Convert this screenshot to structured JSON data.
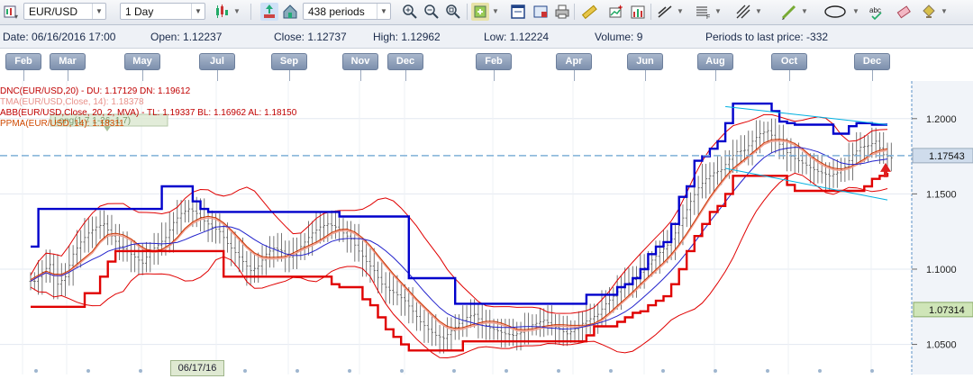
{
  "toolbar": {
    "symbol": "EUR/USD",
    "timeframe": "1 Day",
    "periods": "438 periods"
  },
  "info": {
    "date": "Date: 06/16/2016 17:00",
    "open": "Open: 1.12237",
    "close": "Close: 1.12737",
    "high": "High: 1.12962",
    "low": "Low: 1.12224",
    "volume": "Volume: 9",
    "periods_to_last": "Periods to last price: -332"
  },
  "months": [
    "Feb",
    "Mar",
    "May",
    "Jul",
    "Sep",
    "Nov",
    "Dec",
    "Feb",
    "Apr",
    "Jun",
    "Aug",
    "Oct",
    "Dec"
  ],
  "legend": [
    {
      "text": "DNC(EUR/USD,20) - DU: 1.17129  DN: 1.19612",
      "color": "#c00000"
    },
    {
      "text": "TMA(EUR/USD,Close, 14): 1.18378",
      "color": "#e8908a"
    },
    {
      "text": "ABB(EUR/USD,Close, 20, 2, MVA) - TL: 1.19337  BL: 1.16962  AL: 1.18150",
      "color": "#c00000"
    },
    {
      "text": "PPMA(EUR/USD, 14): 1.18311",
      "color": "#d04a00"
    }
  ],
  "overlay_tag": "Long(1.7 1-26. 1.7)",
  "bottom_date": "06/17/16",
  "chart_data": {
    "type": "line",
    "y_ticks": [
      "1.2000",
      "1.1500",
      "1.1000",
      "1.0500"
    ],
    "ylim": [
      1.03,
      1.225
    ],
    "current_price": "1.17543",
    "crosshair_price": "1.07314",
    "colors": {
      "donchian_upper": "#0000cc",
      "donchian_lower": "#e00000",
      "bollinger": "#e00000",
      "ma": "#cc3300",
      "ma_blue": "#2222cc",
      "bars": "#555555",
      "channel": "#00b0e0",
      "crosshair": "#7fb0d8"
    },
    "series": [
      {
        "name": "Close",
        "values": [
          1.092,
          1.098,
          1.103,
          1.09,
          1.095,
          1.11,
          1.118,
          1.124,
          1.128,
          1.13,
          1.122,
          1.115,
          1.112,
          1.108,
          1.104,
          1.112,
          1.116,
          1.121,
          1.131,
          1.137,
          1.14,
          1.137,
          1.132,
          1.128,
          1.125,
          1.117,
          1.111,
          1.105,
          1.099,
          1.102,
          1.11,
          1.114,
          1.112,
          1.108,
          1.112,
          1.118,
          1.124,
          1.128,
          1.13,
          1.128,
          1.124,
          1.12,
          1.112,
          1.105,
          1.099,
          1.09,
          1.086,
          1.083,
          1.079,
          1.072,
          1.065,
          1.06,
          1.056,
          1.054,
          1.059,
          1.064,
          1.068,
          1.07,
          1.064,
          1.061,
          1.059,
          1.057,
          1.056,
          1.058,
          1.062,
          1.064,
          1.066,
          1.063,
          1.06,
          1.057,
          1.06,
          1.064,
          1.067,
          1.07,
          1.077,
          1.082,
          1.088,
          1.091,
          1.095,
          1.101,
          1.106,
          1.111,
          1.116,
          1.124,
          1.134,
          1.145,
          1.154,
          1.16,
          1.164,
          1.166,
          1.173,
          1.178,
          1.179,
          1.185,
          1.19,
          1.192,
          1.186,
          1.18,
          1.175,
          1.172,
          1.169,
          1.166,
          1.164,
          1.162,
          1.164,
          1.168,
          1.176,
          1.181,
          1.182,
          1.185,
          1.176,
          1.174
        ]
      },
      {
        "name": "Donchian Upper",
        "values": [
          1.115,
          1.14,
          1.14,
          1.14,
          1.14,
          1.14,
          1.14,
          1.14,
          1.14,
          1.14,
          1.14,
          1.14,
          1.14,
          1.14,
          1.14,
          1.14,
          1.14,
          1.155,
          1.155,
          1.155,
          1.155,
          1.145,
          1.14,
          1.138,
          1.138,
          1.138,
          1.138,
          1.138,
          1.138,
          1.138,
          1.138,
          1.138,
          1.138,
          1.138,
          1.138,
          1.138,
          1.138,
          1.138,
          1.138,
          1.138,
          1.135,
          1.135,
          1.135,
          1.135,
          1.135,
          1.135,
          1.135,
          1.135,
          1.135,
          1.094,
          1.094,
          1.094,
          1.094,
          1.094,
          1.094,
          1.077,
          1.077,
          1.077,
          1.077,
          1.077,
          1.077,
          1.077,
          1.077,
          1.077,
          1.077,
          1.077,
          1.077,
          1.077,
          1.077,
          1.077,
          1.077,
          1.077,
          1.083,
          1.083,
          1.083,
          1.083,
          1.088,
          1.09,
          1.094,
          1.1,
          1.11,
          1.115,
          1.118,
          1.13,
          1.148,
          1.155,
          1.172,
          1.175,
          1.18,
          1.185,
          1.197,
          1.21,
          1.21,
          1.21,
          1.21,
          1.21,
          1.205,
          1.198,
          1.197,
          1.196,
          1.196,
          1.196,
          1.196,
          1.196,
          1.19,
          1.19,
          1.195,
          1.197,
          1.197,
          1.196,
          1.196,
          1.196
        ]
      },
      {
        "name": "Donchian Lower",
        "values": [
          1.075,
          1.075,
          1.075,
          1.075,
          1.075,
          1.075,
          1.075,
          1.084,
          1.084,
          1.095,
          1.105,
          1.112,
          1.112,
          1.112,
          1.112,
          1.112,
          1.112,
          1.112,
          1.112,
          1.112,
          1.112,
          1.112,
          1.112,
          1.112,
          1.112,
          1.095,
          1.095,
          1.095,
          1.095,
          1.095,
          1.095,
          1.095,
          1.095,
          1.095,
          1.095,
          1.095,
          1.095,
          1.095,
          1.095,
          1.09,
          1.088,
          1.088,
          1.088,
          1.08,
          1.076,
          1.068,
          1.06,
          1.055,
          1.05,
          1.046,
          1.046,
          1.046,
          1.046,
          1.046,
          1.046,
          1.046,
          1.052,
          1.052,
          1.052,
          1.052,
          1.052,
          1.052,
          1.052,
          1.052,
          1.052,
          1.052,
          1.052,
          1.052,
          1.052,
          1.052,
          1.052,
          1.052,
          1.056,
          1.062,
          1.062,
          1.062,
          1.065,
          1.068,
          1.071,
          1.072,
          1.076,
          1.079,
          1.082,
          1.09,
          1.1,
          1.112,
          1.122,
          1.13,
          1.138,
          1.142,
          1.15,
          1.162,
          1.162,
          1.162,
          1.162,
          1.162,
          1.162,
          1.162,
          1.156,
          1.152,
          1.152,
          1.152,
          1.152,
          1.152,
          1.152,
          1.152,
          1.152,
          1.152,
          1.155,
          1.16,
          1.162,
          1.164
        ]
      }
    ]
  }
}
